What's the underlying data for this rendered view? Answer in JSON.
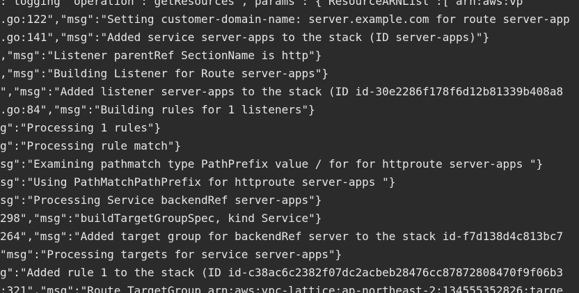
{
  "terminal": {
    "lines": [
      ": logging  operation : getResources , params : {\"ResourceARNList\":[\"arn:aws:vp",
      ".go:122\",\"msg\":\"Setting customer-domain-name: server.example.com for route server-app",
      ".go:141\",\"msg\":\"Added service server-apps to the stack (ID server-apps)\"}",
      ",\"msg\":\"Listener parentRef SectionName is http\"}",
      ",\"msg\":\"Building Listener for Route server-apps\"}",
      "\",\"msg\":\"Added listener server-apps to the stack (ID id-30e2286f178f6d12b81339b408a8",
      ".go:84\",\"msg\":\"Building rules for 1 listeners\"}",
      "g\":\"Processing 1 rules\"}",
      "g\":\"Processing rule match\"}",
      "sg\":\"Examining pathmatch type PathPrefix value / for for httproute server-apps \"}",
      "sg\":\"Using PathMatchPathPrefix for httproute server-apps \"}",
      "sg\":\"Processing Service backendRef server-apps\"}",
      "298\",\"msg\":\"buildTargetGroupSpec, kind Service\"}",
      "264\",\"msg\":\"Added target group for backendRef server to the stack id-f7d138d4c813bc7",
      "\"msg\":\"Processing targets for service server-apps\"}",
      "g\":\"Added rule 1 to the stack (ID id-c38ac6c2382f07dc2acbeb28476cc87872808470f9f06b3",
      ":321\",\"msg\":\"Route TargetGroup arn:aws:vpc-lattice:ap-northeast-2:134555352826:targe"
    ]
  }
}
